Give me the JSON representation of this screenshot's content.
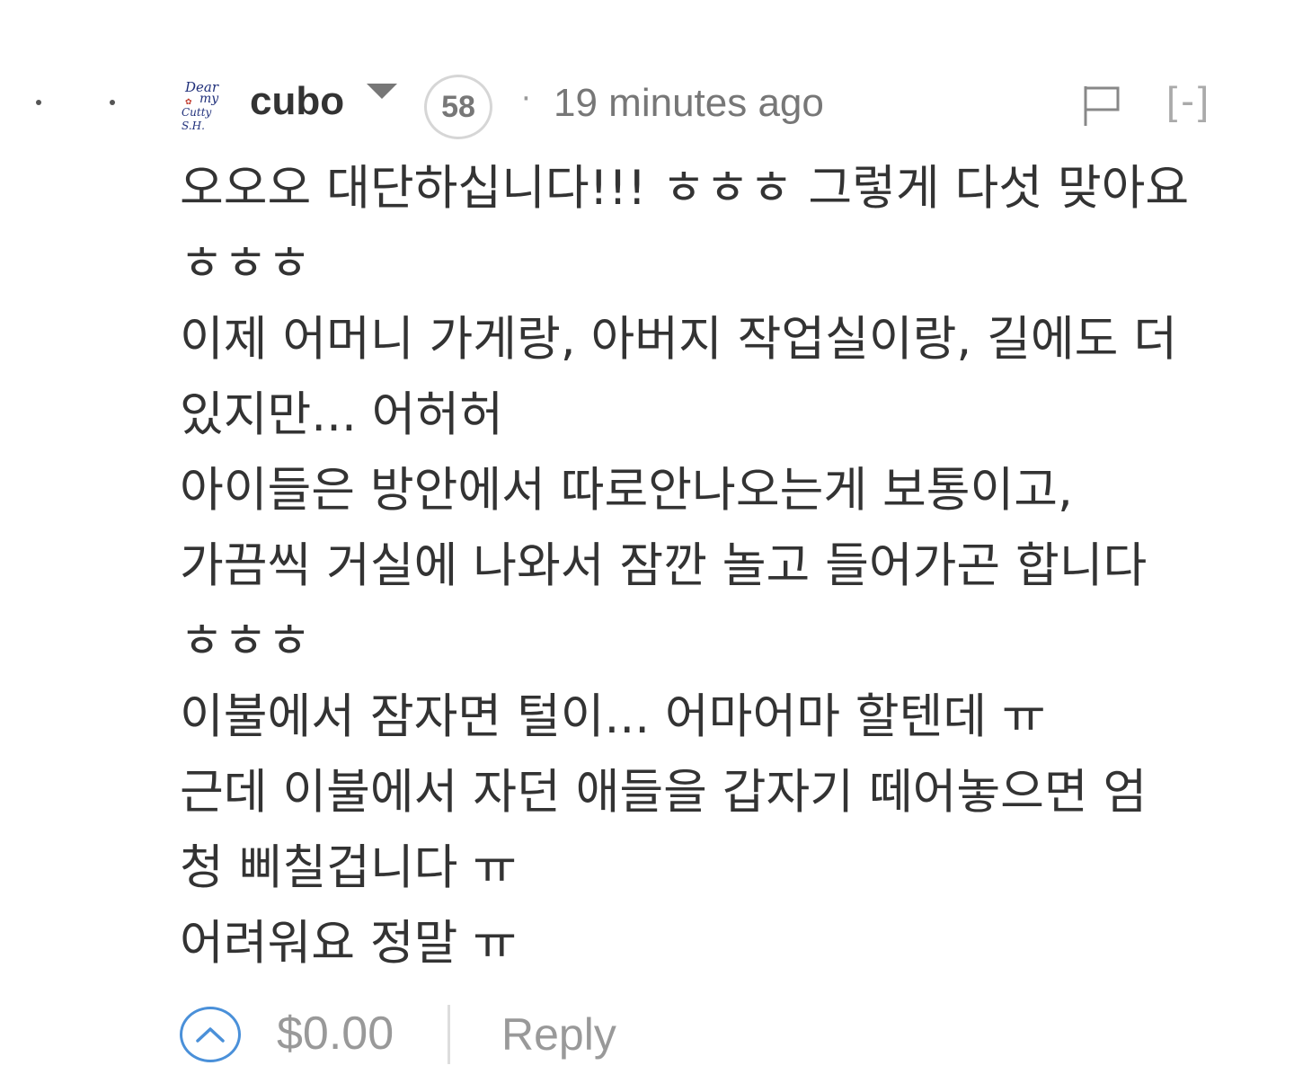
{
  "comment": {
    "author": "cubo",
    "avatar_text": [
      "Dear",
      "my",
      "Cutty S.H."
    ],
    "reputation": "58",
    "separator": "·",
    "timestamp": "19 minutes ago",
    "collapse_label": "[-]",
    "body_lines": [
      "오오오 대단하십니다!!! ㅎㅎㅎ 그렇게 다섯 맞아요",
      "ㅎㅎㅎ",
      "이제 어머니 가게랑, 아버지 작업실이랑, 길에도 더",
      "있지만... 어허허",
      "아이들은 방안에서 따로안나오는게 보통이고,",
      "가끔씩 거실에 나와서 잠깐 놀고 들어가곤 합니다",
      "ㅎㅎㅎ",
      "이불에서 잠자면 털이... 어마어마 할텐데 ㅠ",
      "근데 이불에서 자던 애들을 갑자기 떼어놓으면 엄",
      "청 삐칠겁니다 ㅠ",
      "어려워요 정말 ㅠ"
    ],
    "payout": "$0.00",
    "reply_label": "Reply"
  },
  "colors": {
    "accent_upvote": "#4a90d9",
    "text": "#333333",
    "muted": "#777777"
  },
  "icons": [
    "flag-icon",
    "upvote-chevron-icon",
    "author-menu-caret-icon"
  ]
}
